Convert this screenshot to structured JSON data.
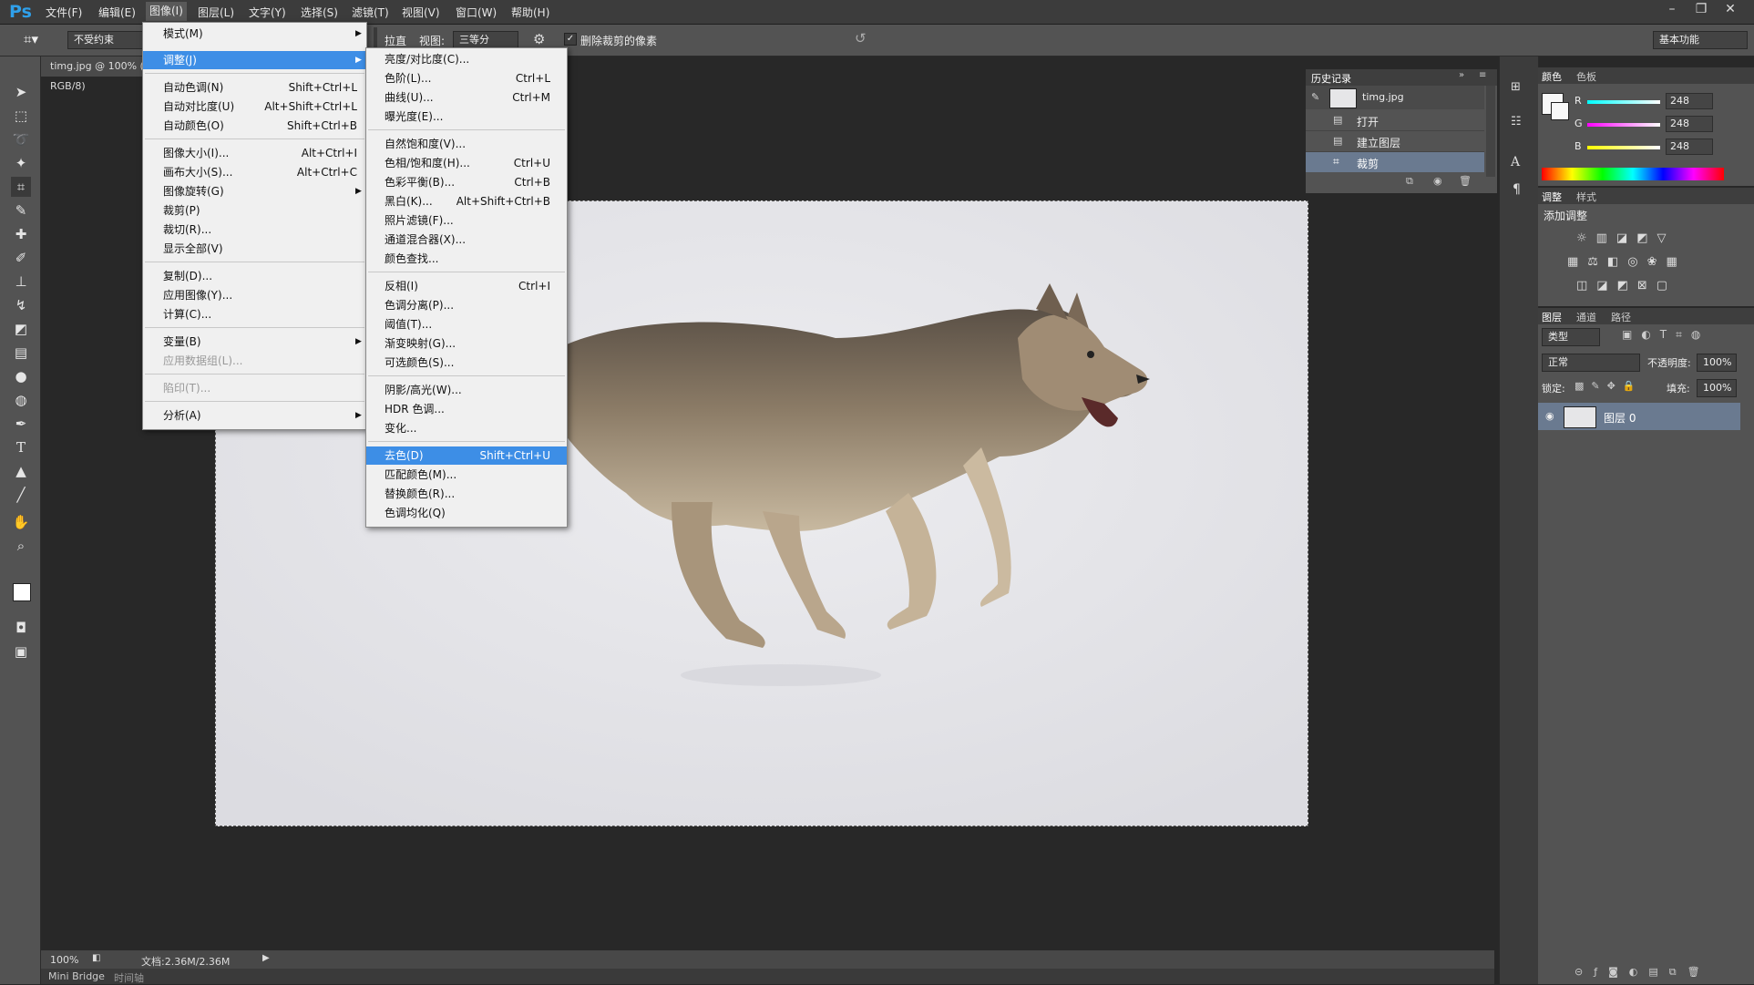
{
  "app": {
    "logo": "Ps"
  },
  "menubar": {
    "items": [
      "文件(F)",
      "编辑(E)",
      "图像(I)",
      "图层(L)",
      "文字(Y)",
      "选择(S)",
      "滤镜(T)",
      "视图(V)",
      "窗口(W)",
      "帮助(H)"
    ],
    "active_index": 2
  },
  "window_controls": {
    "minimize": "–",
    "restore": "❐",
    "close": "✕"
  },
  "options": {
    "ratio_value": "不受约束",
    "straighten_label": "拉直",
    "view_label": "视图:",
    "view_value": "三等分",
    "delete_crop_label": "删除裁剪的像素",
    "delete_crop_checked": true,
    "workspace_value": "基本功能"
  },
  "document": {
    "tab_title": "timg.jpg @ 100% (图层 0, RGB/8)",
    "zoom": "100%",
    "doc_size": "文档:2.36M/2.36M"
  },
  "bottom": {
    "mini_bridge": "Mini Bridge",
    "timeline": "时间轴"
  },
  "image_menu": {
    "items": [
      {
        "label": "模式(M)",
        "shortcut": "",
        "submenu": true
      },
      {
        "label": "调整(J)",
        "shortcut": "",
        "submenu": true,
        "highlight": true
      },
      {
        "label": "自动色调(N)",
        "shortcut": "Shift+Ctrl+L"
      },
      {
        "label": "自动对比度(U)",
        "shortcut": "Alt+Shift+Ctrl+L"
      },
      {
        "label": "自动颜色(O)",
        "shortcut": "Shift+Ctrl+B"
      },
      {
        "label": "图像大小(I)...",
        "shortcut": "Alt+Ctrl+I"
      },
      {
        "label": "画布大小(S)...",
        "shortcut": "Alt+Ctrl+C"
      },
      {
        "label": "图像旋转(G)",
        "shortcut": "",
        "submenu": true
      },
      {
        "label": "裁剪(P)",
        "shortcut": ""
      },
      {
        "label": "裁切(R)...",
        "shortcut": ""
      },
      {
        "label": "显示全部(V)",
        "shortcut": ""
      },
      {
        "label": "复制(D)...",
        "shortcut": ""
      },
      {
        "label": "应用图像(Y)...",
        "shortcut": ""
      },
      {
        "label": "计算(C)...",
        "shortcut": ""
      },
      {
        "label": "变量(B)",
        "shortcut": "",
        "submenu": true
      },
      {
        "label": "应用数据组(L)...",
        "shortcut": "",
        "disabled": true
      },
      {
        "label": "陷印(T)...",
        "shortcut": "",
        "disabled": true
      },
      {
        "label": "分析(A)",
        "shortcut": "",
        "submenu": true
      }
    ]
  },
  "adjust_menu": {
    "items": [
      {
        "label": "亮度/对比度(C)...",
        "shortcut": ""
      },
      {
        "label": "色阶(L)...",
        "shortcut": "Ctrl+L"
      },
      {
        "label": "曲线(U)...",
        "shortcut": "Ctrl+M"
      },
      {
        "label": "曝光度(E)...",
        "shortcut": ""
      },
      {
        "label": "自然饱和度(V)...",
        "shortcut": ""
      },
      {
        "label": "色相/饱和度(H)...",
        "shortcut": "Ctrl+U"
      },
      {
        "label": "色彩平衡(B)...",
        "shortcut": "Ctrl+B"
      },
      {
        "label": "黑白(K)...",
        "shortcut": "Alt+Shift+Ctrl+B"
      },
      {
        "label": "照片滤镜(F)...",
        "shortcut": ""
      },
      {
        "label": "通道混合器(X)...",
        "shortcut": ""
      },
      {
        "label": "颜色查找...",
        "shortcut": ""
      },
      {
        "label": "反相(I)",
        "shortcut": "Ctrl+I"
      },
      {
        "label": "色调分离(P)...",
        "shortcut": ""
      },
      {
        "label": "阈值(T)...",
        "shortcut": ""
      },
      {
        "label": "渐变映射(G)...",
        "shortcut": ""
      },
      {
        "label": "可选颜色(S)...",
        "shortcut": ""
      },
      {
        "label": "阴影/高光(W)...",
        "shortcut": ""
      },
      {
        "label": "HDR 色调...",
        "shortcut": ""
      },
      {
        "label": "变化...",
        "shortcut": ""
      },
      {
        "label": "去色(D)",
        "shortcut": "Shift+Ctrl+U",
        "highlight": true
      },
      {
        "label": "匹配颜色(M)...",
        "shortcut": ""
      },
      {
        "label": "替换颜色(R)...",
        "shortcut": ""
      },
      {
        "label": "色调均化(Q)",
        "shortcut": ""
      }
    ]
  },
  "history": {
    "tab_label": "历史记录",
    "snapshot": "timg.jpg",
    "items": [
      "打开",
      "建立图层",
      "裁剪"
    ]
  },
  "color_panel": {
    "tabs": [
      "颜色",
      "色板"
    ],
    "r_label": "R",
    "g_label": "G",
    "b_label": "B",
    "r": "248",
    "g": "248",
    "b": "248"
  },
  "adjust_panel": {
    "tabs": [
      "调整",
      "样式"
    ],
    "title": "添加调整"
  },
  "layers_panel": {
    "tabs": [
      "图层",
      "通道",
      "路径"
    ],
    "kind_label": "类型",
    "blend_mode": "正常",
    "opacity_label": "不透明度:",
    "opacity_value": "100%",
    "lock_label": "锁定:",
    "fill_label": "填充:",
    "fill_value": "100%",
    "layer_name": "图层 0"
  },
  "colors": {
    "accent": "#3d8ee6",
    "ps_blue": "#2fa0ea",
    "dark_bg": "#282828",
    "panel": "#535353"
  }
}
